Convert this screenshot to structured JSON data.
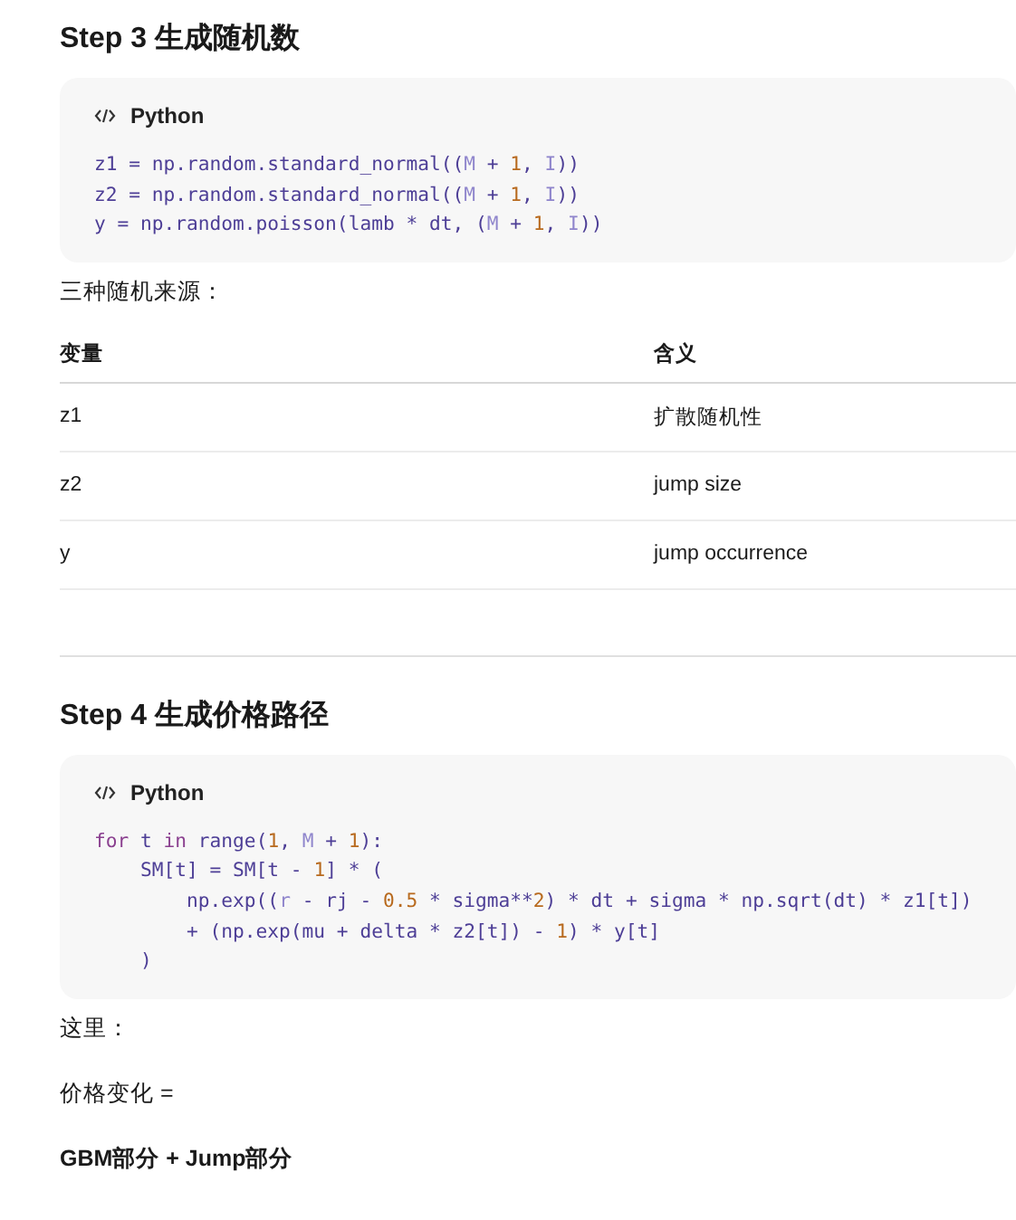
{
  "blocks": [
    {
      "kind": "heading",
      "text": "Step 3 生成随机数"
    },
    {
      "kind": "code",
      "language": "Python",
      "lines": [
        [
          {
            "text": "z1 = np.random.standard_normal((",
            "kind": "plain"
          },
          {
            "text": "M",
            "kind": "const"
          },
          {
            "text": " + ",
            "kind": "plain"
          },
          {
            "text": "1",
            "kind": "number"
          },
          {
            "text": ", ",
            "kind": "plain"
          },
          {
            "text": "I",
            "kind": "const"
          },
          {
            "text": "))",
            "kind": "plain"
          }
        ],
        [
          {
            "text": "z2 = np.random.standard_normal((",
            "kind": "plain"
          },
          {
            "text": "M",
            "kind": "const"
          },
          {
            "text": " + ",
            "kind": "plain"
          },
          {
            "text": "1",
            "kind": "number"
          },
          {
            "text": ", ",
            "kind": "plain"
          },
          {
            "text": "I",
            "kind": "const"
          },
          {
            "text": "))",
            "kind": "plain"
          }
        ],
        [
          {
            "text": "y = np.random.poisson(lamb * dt, (",
            "kind": "plain"
          },
          {
            "text": "M",
            "kind": "const"
          },
          {
            "text": " + ",
            "kind": "plain"
          },
          {
            "text": "1",
            "kind": "number"
          },
          {
            "text": ", ",
            "kind": "plain"
          },
          {
            "text": "I",
            "kind": "const"
          },
          {
            "text": "))",
            "kind": "plain"
          }
        ]
      ]
    },
    {
      "kind": "paragraph",
      "text": "三种随机来源：",
      "bold": false
    },
    {
      "kind": "table",
      "columns": [
        "变量",
        "含义"
      ],
      "rows": [
        [
          "z1",
          "扩散随机性"
        ],
        [
          "z2",
          "jump size"
        ],
        [
          "y",
          "jump occurrence"
        ]
      ]
    },
    {
      "kind": "divider"
    },
    {
      "kind": "heading",
      "text": "Step 4 生成价格路径"
    },
    {
      "kind": "code",
      "language": "Python",
      "lines": [
        [
          {
            "text": "for",
            "kind": "keyword"
          },
          {
            "text": " t ",
            "kind": "plain"
          },
          {
            "text": "in",
            "kind": "keyword"
          },
          {
            "text": " range(",
            "kind": "plain"
          },
          {
            "text": "1",
            "kind": "number"
          },
          {
            "text": ", ",
            "kind": "plain"
          },
          {
            "text": "M",
            "kind": "const"
          },
          {
            "text": " + ",
            "kind": "plain"
          },
          {
            "text": "1",
            "kind": "number"
          },
          {
            "text": "):",
            "kind": "plain"
          }
        ],
        [
          {
            "text": "    SM[t] = SM[t - ",
            "kind": "plain"
          },
          {
            "text": "1",
            "kind": "number"
          },
          {
            "text": "] * (",
            "kind": "plain"
          }
        ],
        [
          {
            "text": "        np.exp((",
            "kind": "plain"
          },
          {
            "text": "r",
            "kind": "const"
          },
          {
            "text": " - rj - ",
            "kind": "plain"
          },
          {
            "text": "0.5",
            "kind": "number"
          },
          {
            "text": " * sigma**",
            "kind": "plain"
          },
          {
            "text": "2",
            "kind": "number"
          },
          {
            "text": ") * dt + sigma * np.sqrt(dt) * z1[t])",
            "kind": "plain"
          }
        ],
        [
          {
            "text": "        + (np.exp(mu + delta * z2[t]) - ",
            "kind": "plain"
          },
          {
            "text": "1",
            "kind": "number"
          },
          {
            "text": ") * y[t]",
            "kind": "plain"
          }
        ],
        [
          {
            "text": "    )",
            "kind": "plain"
          }
        ]
      ]
    },
    {
      "kind": "paragraph",
      "text": "这里：",
      "bold": false
    },
    {
      "kind": "paragraph",
      "text": "价格变化 =",
      "bold": false
    },
    {
      "kind": "paragraph",
      "text": "GBM部分 + Jump部分",
      "bold": true
    }
  ]
}
